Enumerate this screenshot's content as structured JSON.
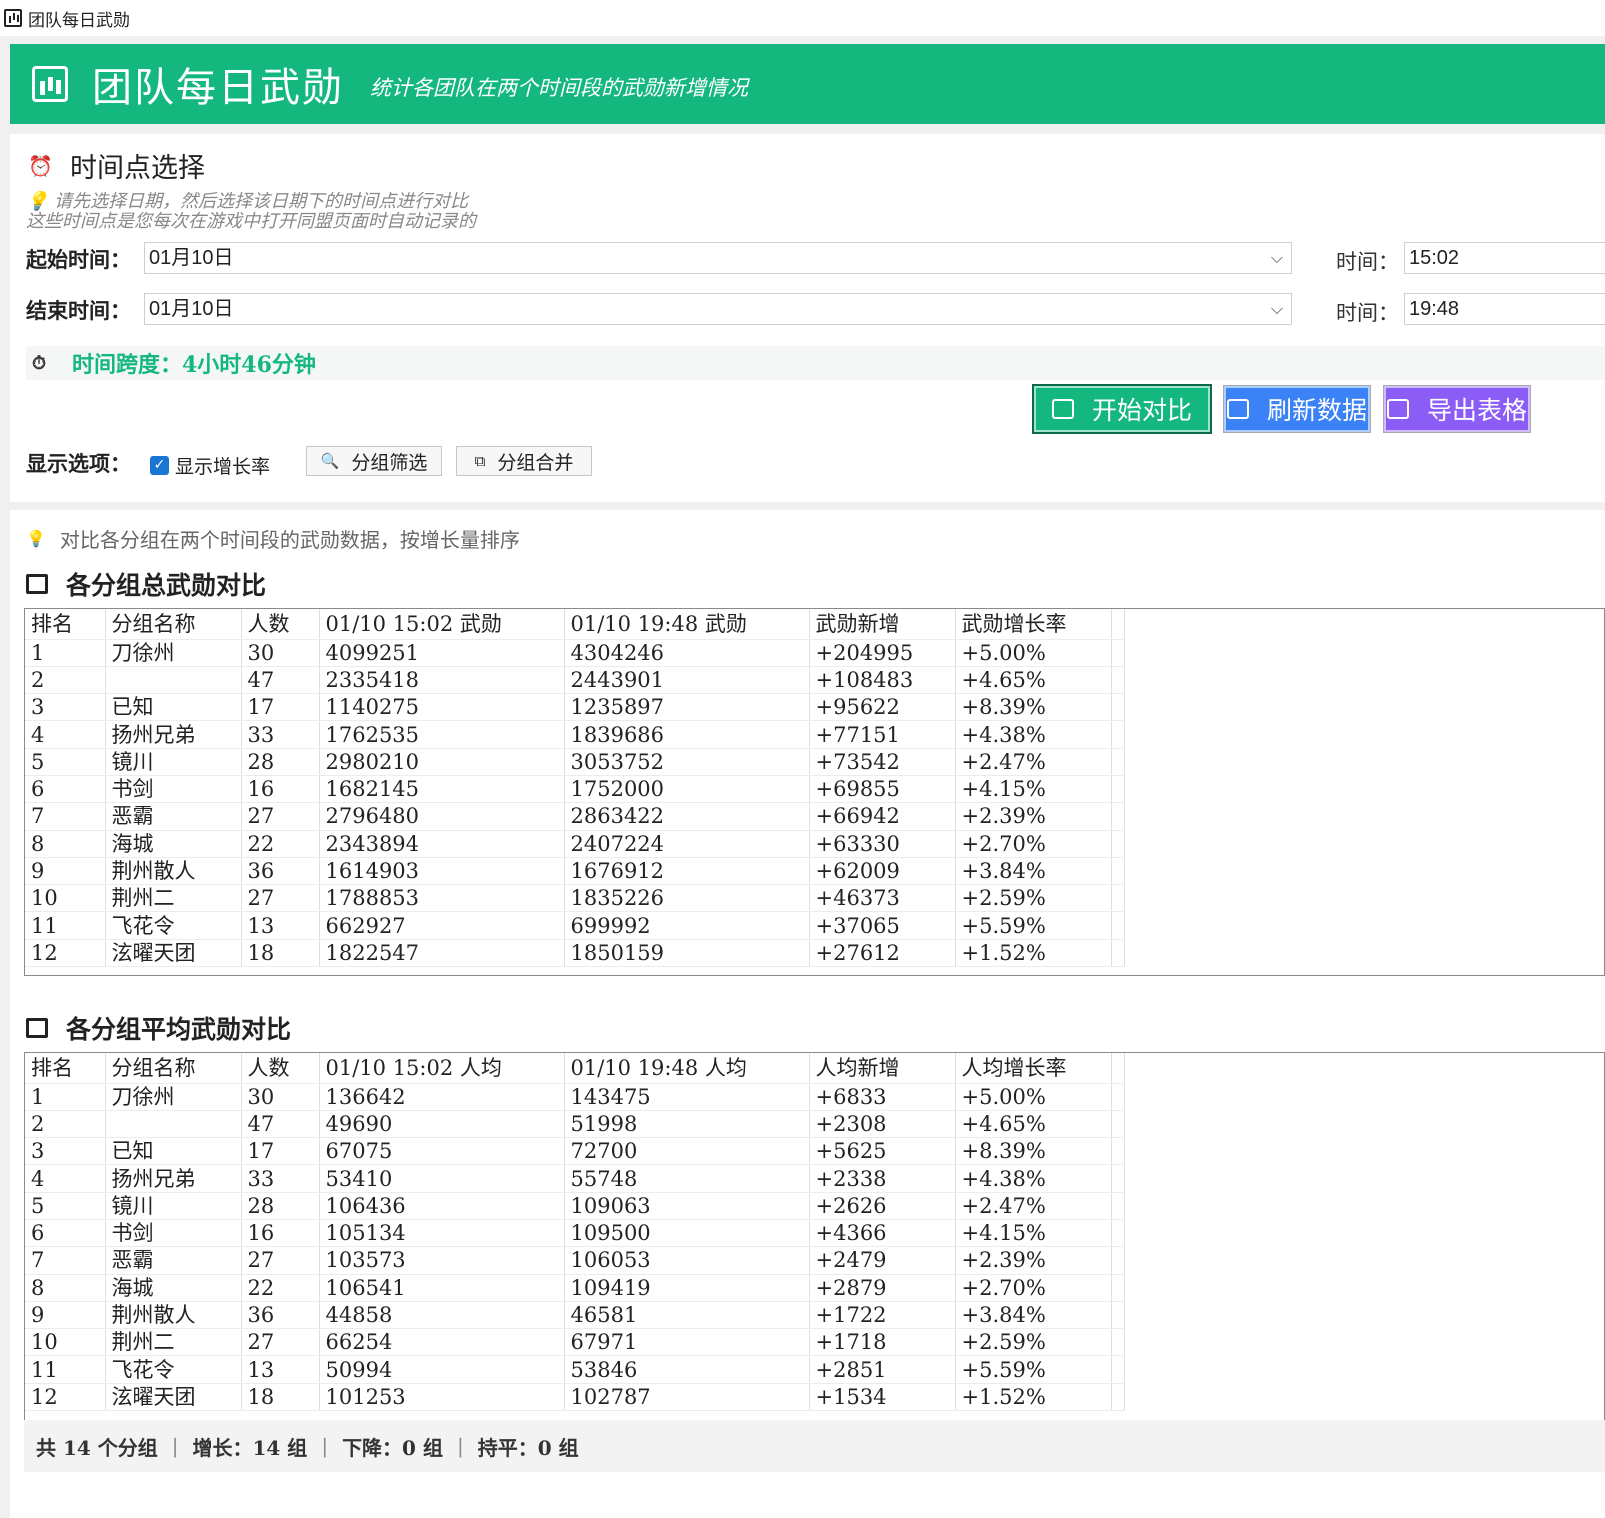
{
  "window": {
    "title": "团队每日武勋"
  },
  "banner": {
    "title": "团队每日武勋",
    "subtitle": "统计各团队在两个时间段的武勋新增情况"
  },
  "time_select": {
    "title": "时间点选择",
    "hint_line1": "请先选择日期，然后选择该日期下的时间点进行对比",
    "hint_line2": "这些时间点是您每次在游戏中打开同盟页面时自动记录的",
    "start_label": "起始时间：",
    "start_date": "01月10日",
    "start_time_label": "时间：",
    "start_time": "15:02",
    "end_label": "结束时间：",
    "end_date": "01月10日",
    "end_time_label": "时间：",
    "end_time": "19:48",
    "span_text": "时间跨度：4小时46分钟"
  },
  "actions": {
    "compare": "开始对比",
    "refresh": "刷新数据",
    "export": "导出表格"
  },
  "options": {
    "label": "显示选项：",
    "show_growth": "显示增长率",
    "filter": "分组筛选",
    "merge": "分组合并"
  },
  "note": "对比各分组在两个时间段的武勋数据，按增长量排序",
  "total_table": {
    "title": "各分组总武勋对比",
    "headers": [
      "排名",
      "分组名称",
      "人数",
      "01/10 15:02 武勋",
      "01/10 19:48 武勋",
      "武勋新增",
      "武勋增长率",
      ""
    ],
    "rows": [
      [
        "1",
        "刀徐州",
        "30",
        "4099251",
        "4304246",
        "+204995",
        "+5.00%",
        ""
      ],
      [
        "2",
        "",
        "47",
        "2335418",
        "2443901",
        "+108483",
        "+4.65%",
        ""
      ],
      [
        "3",
        "已知",
        "17",
        "1140275",
        "1235897",
        "+95622",
        "+8.39%",
        ""
      ],
      [
        "4",
        "扬州兄弟",
        "33",
        "1762535",
        "1839686",
        "+77151",
        "+4.38%",
        ""
      ],
      [
        "5",
        "镜川",
        "28",
        "2980210",
        "3053752",
        "+73542",
        "+2.47%",
        ""
      ],
      [
        "6",
        "书剑",
        "16",
        "1682145",
        "1752000",
        "+69855",
        "+4.15%",
        ""
      ],
      [
        "7",
        "恶霸",
        "27",
        "2796480",
        "2863422",
        "+66942",
        "+2.39%",
        ""
      ],
      [
        "8",
        "海城",
        "22",
        "2343894",
        "2407224",
        "+63330",
        "+2.70%",
        ""
      ],
      [
        "9",
        "荆州散人",
        "36",
        "1614903",
        "1676912",
        "+62009",
        "+3.84%",
        ""
      ],
      [
        "10",
        "荆州二",
        "27",
        "1788853",
        "1835226",
        "+46373",
        "+2.59%",
        ""
      ],
      [
        "11",
        "飞花令",
        "13",
        "662927",
        "699992",
        "+37065",
        "+5.59%",
        ""
      ],
      [
        "12",
        "泫曜天团",
        "18",
        "1822547",
        "1850159",
        "+27612",
        "+1.52%",
        ""
      ]
    ]
  },
  "avg_table": {
    "title": "各分组平均武勋对比",
    "headers": [
      "排名",
      "分组名称",
      "人数",
      "01/10 15:02 人均",
      "01/10 19:48 人均",
      "人均新增",
      "人均增长率",
      ""
    ],
    "rows": [
      [
        "1",
        "刀徐州",
        "30",
        "136642",
        "143475",
        "+6833",
        "+5.00%",
        ""
      ],
      [
        "2",
        "",
        "47",
        "49690",
        "51998",
        "+2308",
        "+4.65%",
        ""
      ],
      [
        "3",
        "已知",
        "17",
        "67075",
        "72700",
        "+5625",
        "+8.39%",
        ""
      ],
      [
        "4",
        "扬州兄弟",
        "33",
        "53410",
        "55748",
        "+2338",
        "+4.38%",
        ""
      ],
      [
        "5",
        "镜川",
        "28",
        "106436",
        "109063",
        "+2626",
        "+2.47%",
        ""
      ],
      [
        "6",
        "书剑",
        "16",
        "105134",
        "109500",
        "+4366",
        "+4.15%",
        ""
      ],
      [
        "7",
        "恶霸",
        "27",
        "103573",
        "106053",
        "+2479",
        "+2.39%",
        ""
      ],
      [
        "8",
        "海城",
        "22",
        "106541",
        "109419",
        "+2879",
        "+2.70%",
        ""
      ],
      [
        "9",
        "荆州散人",
        "36",
        "44858",
        "46581",
        "+1722",
        "+3.84%",
        ""
      ],
      [
        "10",
        "荆州二",
        "27",
        "66254",
        "67971",
        "+1718",
        "+2.59%",
        ""
      ],
      [
        "11",
        "飞花令",
        "13",
        "50994",
        "53846",
        "+2851",
        "+5.59%",
        ""
      ],
      [
        "12",
        "泫曜天团",
        "18",
        "101253",
        "102787",
        "+1534",
        "+1.52%",
        ""
      ]
    ]
  },
  "summary": {
    "total": "共 14 个分组",
    "increase": "增长：14 组",
    "decrease": "下降：0 组",
    "flat": "持平：0 组",
    "separator": "|"
  },
  "colors": {
    "accent": "#14b87f",
    "blue": "#3b82f6",
    "purple": "#8b5cf6"
  }
}
